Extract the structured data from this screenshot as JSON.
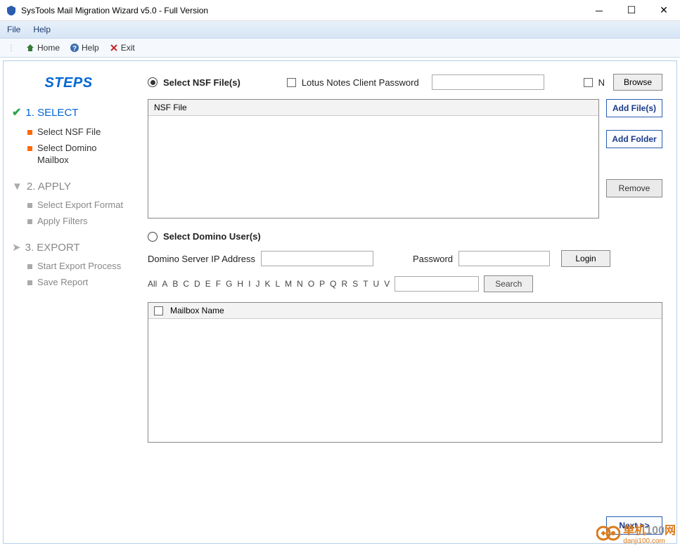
{
  "title": "SysTools Mail Migration Wizard v5.0 - Full Version",
  "menubar": {
    "file": "File",
    "help": "Help"
  },
  "toolbar": {
    "home": "Home",
    "help": "Help",
    "exit": "Exit"
  },
  "sidebar": {
    "title": "STEPS",
    "step1": {
      "head": "1. SELECT",
      "sub1": "Select NSF File",
      "sub2": "Select Domino Mailbox"
    },
    "step2": {
      "head": "2. APPLY",
      "sub1": "Select Export Format",
      "sub2": "Apply Filters"
    },
    "step3": {
      "head": "3. EXPORT",
      "sub1": "Start Export Process",
      "sub2": "Save Report"
    }
  },
  "main": {
    "select_nsf": "Select NSF File(s)",
    "lotus_pw": "Lotus Notes Client Password",
    "n_partial": "N",
    "browse": "Browse",
    "nsf_header": "NSF File",
    "add_files": "Add File(s)",
    "add_folder": "Add Folder",
    "remove": "Remove",
    "select_domino": "Select Domino User(s)",
    "domino_ip": "Domino Server IP Address",
    "password": "Password",
    "login": "Login",
    "alpha": {
      "all": "All",
      "letters": [
        "A",
        "B",
        "C",
        "D",
        "E",
        "F",
        "G",
        "H",
        "I",
        "J",
        "K",
        "L",
        "M",
        "N",
        "O",
        "P",
        "Q",
        "R",
        "S",
        "T",
        "U",
        "V"
      ]
    },
    "search": "Search",
    "mailbox_header": "Mailbox Name",
    "next": "Next >>"
  },
  "watermark": {
    "brand1": "单机",
    "brand2": "100",
    "brand3": "网",
    "url": "danji100.com"
  }
}
